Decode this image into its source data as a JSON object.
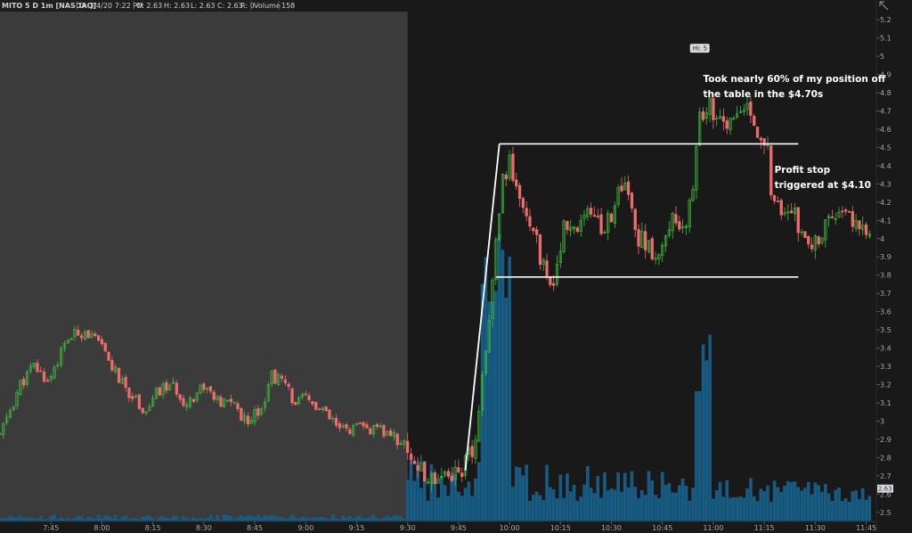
{
  "header": {
    "symbol": "MITO 5 D 1m [NASDAQ]",
    "date": "D: 3/4/20 7:22 PM",
    "open": "O: 2.63",
    "high": "H: 2.63",
    "low": "L: 2.63",
    "close": "C: 2.63",
    "range": "R: 0",
    "volume_label": "Volume",
    "volume_value": "158"
  },
  "colors": {
    "background": "#191919",
    "premarket": "#3b3b3b",
    "up": "#3fbf3f",
    "down": "#f06b6b",
    "volume": "#175a82",
    "annotation": "#ffffff"
  },
  "chart_data": {
    "type": "candlestick",
    "x_ticks": [
      "7:45",
      "8:00",
      "8:15",
      "8:30",
      "8:45",
      "9:00",
      "9:15",
      "9:30",
      "9:45",
      "10:00",
      "10:15",
      "10:30",
      "10:45",
      "11:00",
      "11:15",
      "11:30",
      "11:45"
    ],
    "y_ticks": [
      "2.5",
      "2.6",
      "2.7",
      "2.8",
      "2.9",
      "3",
      "3.1",
      "3.2",
      "3.3",
      "3.4",
      "3.5",
      "3.6",
      "3.7",
      "3.8",
      "3.9",
      "4",
      "4.1",
      "4.2",
      "4.3",
      "4.4",
      "4.5",
      "4.6",
      "4.7",
      "4.8",
      "4.9",
      "5",
      "5.1",
      "5.2"
    ],
    "ylim": [
      2.45,
      5.24
    ],
    "premarket_end": "9:30",
    "hi_label": "Hi: 5",
    "hi": {
      "time": "10:56",
      "price": 5.0
    },
    "last_price_label": "2.63",
    "last_price": 2.63,
    "price_path": [
      [
        "7:30",
        2.92
      ],
      [
        "7:36",
        3.2
      ],
      [
        "7:40",
        3.3
      ],
      [
        "7:44",
        3.22
      ],
      [
        "7:50",
        3.45
      ],
      [
        "7:55",
        3.5
      ],
      [
        "8:00",
        3.4
      ],
      [
        "8:03",
        3.3
      ],
      [
        "8:06",
        3.2
      ],
      [
        "8:10",
        3.12
      ],
      [
        "8:13",
        3.05
      ],
      [
        "8:16",
        3.15
      ],
      [
        "8:20",
        3.2
      ],
      [
        "8:25",
        3.1
      ],
      [
        "8:30",
        3.2
      ],
      [
        "8:35",
        3.08
      ],
      [
        "8:38",
        3.12
      ],
      [
        "8:42",
        3.0
      ],
      [
        "8:47",
        3.08
      ],
      [
        "8:50",
        3.25
      ],
      [
        "8:53",
        3.22
      ],
      [
        "8:57",
        3.1
      ],
      [
        "9:00",
        3.12
      ],
      [
        "9:05",
        3.05
      ],
      [
        "9:10",
        2.95
      ],
      [
        "9:15",
        2.96
      ],
      [
        "9:20",
        2.95
      ],
      [
        "9:25",
        2.93
      ],
      [
        "9:30",
        2.85
      ],
      [
        "9:35",
        2.68
      ],
      [
        "9:40",
        2.72
      ],
      [
        "9:45",
        2.72
      ],
      [
        "9:50",
        2.85
      ],
      [
        "9:52",
        3.2
      ],
      [
        "9:54",
        3.6
      ],
      [
        "9:56",
        3.95
      ],
      [
        "9:58",
        4.3
      ],
      [
        "10:00",
        4.4
      ],
      [
        "10:03",
        4.22
      ],
      [
        "10:06",
        4.1
      ],
      [
        "10:10",
        3.85
      ],
      [
        "10:13",
        3.78
      ],
      [
        "10:16",
        4.05
      ],
      [
        "10:20",
        4.0
      ],
      [
        "10:23",
        4.2
      ],
      [
        "10:27",
        4.05
      ],
      [
        "10:30",
        4.15
      ],
      [
        "10:34",
        4.3
      ],
      [
        "10:37",
        4.05
      ],
      [
        "10:40",
        3.95
      ],
      [
        "10:44",
        3.9
      ],
      [
        "10:47",
        4.1
      ],
      [
        "10:51",
        4.05
      ],
      [
        "10:54",
        4.25
      ],
      [
        "10:56",
        4.65
      ],
      [
        "10:58",
        4.75
      ],
      [
        "11:00",
        4.7
      ],
      [
        "11:04",
        4.62
      ],
      [
        "11:07",
        4.65
      ],
      [
        "11:10",
        4.72
      ],
      [
        "11:13",
        4.6
      ],
      [
        "11:16",
        4.55
      ],
      [
        "11:17",
        4.2
      ],
      [
        "11:20",
        4.12
      ],
      [
        "11:24",
        4.15
      ],
      [
        "11:27",
        3.95
      ],
      [
        "11:30",
        4.0
      ],
      [
        "11:34",
        4.1
      ],
      [
        "11:38",
        4.15
      ],
      [
        "11:45",
        4.05
      ]
    ],
    "annotations": [
      {
        "lines": [
          "Took nearly 60% of my position off",
          "the table in the $4.70s"
        ],
        "time": "10:57",
        "price": 4.86
      },
      {
        "lines": [
          "Profit stop",
          "triggered at $4.10"
        ],
        "time": "11:18",
        "price": 4.36
      }
    ],
    "drawn_levels": [
      {
        "price": 4.52,
        "from": "9:57",
        "to": "11:25"
      },
      {
        "price": 3.79,
        "from": "9:56",
        "to": "11:25"
      }
    ],
    "trend_line": {
      "from": [
        "9:47",
        2.73
      ],
      "to": [
        "9:57",
        4.52
      ]
    }
  }
}
